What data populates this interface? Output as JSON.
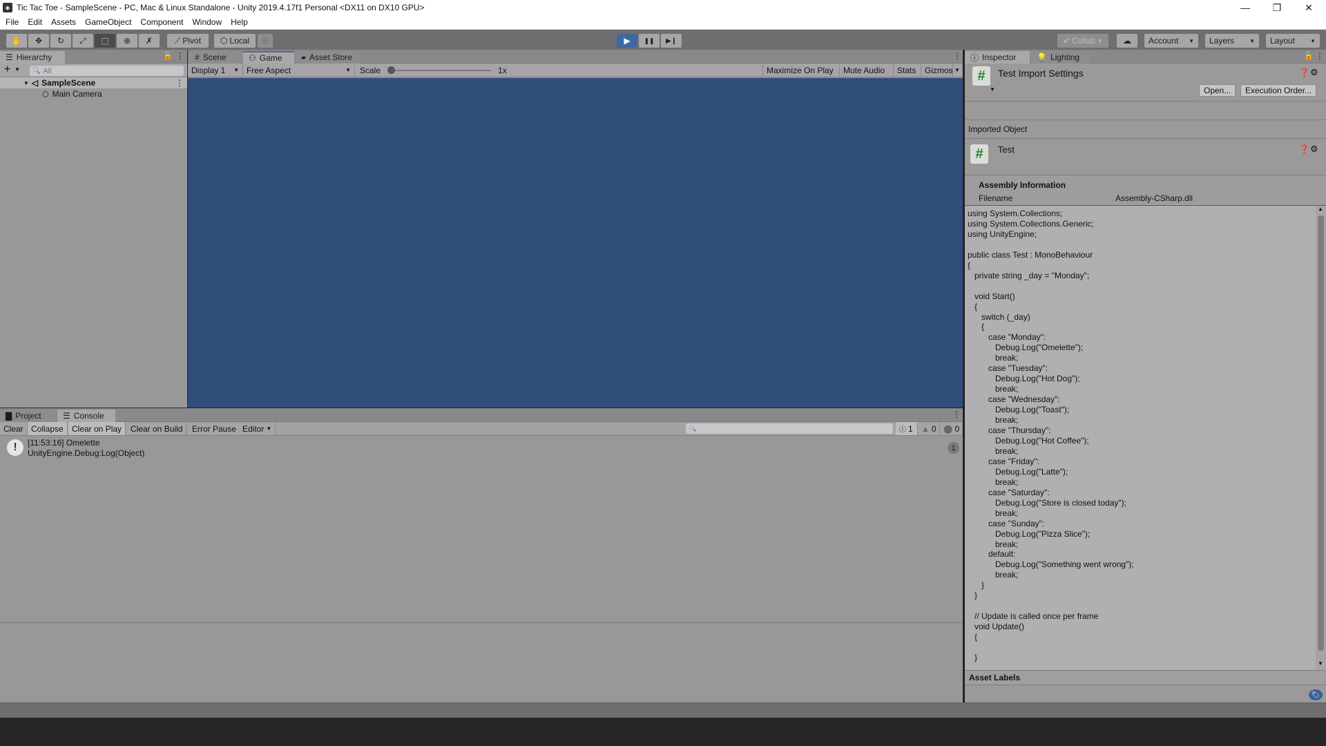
{
  "window": {
    "title": "Tic Tac Toe - SampleScene - PC, Mac & Linux Standalone - Unity 2019.4.17f1 Personal <DX11 on DX10 GPU>",
    "controls": {
      "minimize": "—",
      "maximize": "❐",
      "close": "✕"
    }
  },
  "menu": [
    "File",
    "Edit",
    "Assets",
    "GameObject",
    "Component",
    "Window",
    "Help"
  ],
  "toolbar": {
    "tools": [
      {
        "name": "hand-tool",
        "glyph": "✋"
      },
      {
        "name": "move-tool",
        "glyph": "✥"
      },
      {
        "name": "rotate-tool",
        "glyph": "↻"
      },
      {
        "name": "scale-tool",
        "glyph": "⤢"
      },
      {
        "name": "rect-tool",
        "glyph": "⬚"
      },
      {
        "name": "transform-tool",
        "glyph": "⊕"
      },
      {
        "name": "custom-tool",
        "glyph": "✗"
      }
    ],
    "pivot_label": "Pivot",
    "local_label": "Local",
    "snap_glyph": "⊞",
    "play_glyph": "▶",
    "pause_glyph": "❚❚",
    "step_glyph": "▶❙",
    "collab_label": "Collab",
    "cloud_glyph": "☁",
    "account_label": "Account",
    "layers_label": "Layers",
    "layout_label": "Layout"
  },
  "hierarchy": {
    "tab_label": "Hierarchy",
    "search_placeholder": "All",
    "add_glyph": "+",
    "scene_name": "SampleScene",
    "items": [
      {
        "label": "Main Camera"
      }
    ]
  },
  "game_view": {
    "tabs": [
      {
        "label": "Scene",
        "glyph": "#"
      },
      {
        "label": "Game",
        "glyph": "⚇"
      },
      {
        "label": "Asset Store",
        "glyph": "🔒"
      }
    ],
    "display": "Display 1",
    "aspect": "Free Aspect",
    "scale_label": "Scale",
    "scale_value": "1x",
    "scale_fraction": 0,
    "maximize_label": "Maximize On Play",
    "mute_label": "Mute Audio",
    "stats_label": "Stats",
    "gizmos_label": "Gizmos",
    "background": "#314d7a"
  },
  "console": {
    "tabs": [
      {
        "label": "Project"
      },
      {
        "label": "Console"
      }
    ],
    "buttons": [
      "Clear",
      "Collapse",
      "Clear on Play",
      "Clear on Build",
      "Error Pause",
      "Editor"
    ],
    "search_placeholder": "",
    "counts": {
      "log": "1",
      "warning": "0",
      "error": "0"
    },
    "entries": [
      {
        "line1": "[11:53:16] Omelette",
        "line2": "UnityEngine.Debug:Log(Object)",
        "count": "1"
      }
    ]
  },
  "inspector": {
    "tabs": [
      {
        "label": "Inspector"
      },
      {
        "label": "Lighting"
      }
    ],
    "header_title": "Test Import Settings",
    "open_label": "Open...",
    "execution_order_label": "Execution Order...",
    "imported_object_label": "Imported Object",
    "object_name": "Test",
    "assembly_info_label": "Assembly Information",
    "filename_label": "Filename",
    "filename_value": "Assembly-CSharp.dll",
    "code": "using System.Collections;\nusing System.Collections.Generic;\nusing UnityEngine;\n\npublic class Test : MonoBehaviour\n{\n   private string _day = \"Monday\";\n\n   void Start()\n   {\n      switch (_day)\n      {\n         case \"Monday\":\n            Debug.Log(\"Omelette\");\n            break;\n         case \"Tuesday\":\n            Debug.Log(\"Hot Dog\");\n            break;\n         case \"Wednesday\":\n            Debug.Log(\"Toast\");\n            break;\n         case \"Thursday\":\n            Debug.Log(\"Hot Coffee\");\n            break;\n         case \"Friday\":\n            Debug.Log(\"Latte\");\n            break;\n         case \"Saturday\":\n            Debug.Log(\"Store is closed today\");\n            break;\n         case \"Sunday\":\n            Debug.Log(\"Pizza Slice\");\n            break;\n         default:\n            Debug.Log(\"Something went wrong\");\n            break;\n      }\n   }\n\n   // Update is called once per frame\n   void Update()\n   {\n\n   }",
    "asset_labels_label": "Asset Labels"
  }
}
